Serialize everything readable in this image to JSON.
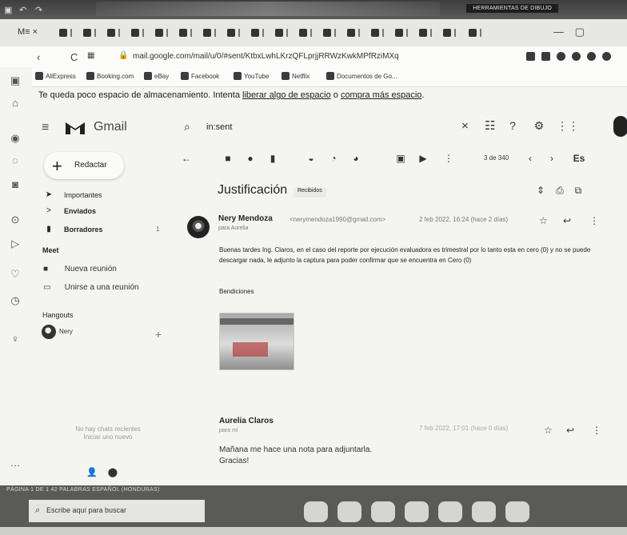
{
  "browser": {
    "word_title_mark": "HERRAMIENTAS DE DIBUJO",
    "tab_strip_text": "M≡  ×",
    "url": "mail.google.com/mail/u/0/#sent/KtbxLwhLKrzQFLprjjRRWzKwkMPfRziMXq",
    "bookmarks": [
      "AliExpress",
      "Booking.com",
      "eBay",
      "Facebook",
      "YouTube",
      "Netflix",
      "Documentos de Go..."
    ]
  },
  "banner": {
    "text": "Te queda poco espacio de almacenamiento. Intenta ",
    "link1": "liberar algo de espacio",
    "middle": " o ",
    "link2": "compra más espacio",
    "tail": "."
  },
  "gmail": {
    "brand": "Gmail",
    "search_value": "in:sent",
    "compose_label": "Redactar",
    "sidebar": [
      {
        "label": "Importantes",
        "count": "",
        "bold": false
      },
      {
        "label": "Enviados",
        "count": "",
        "bold": true
      },
      {
        "label": "Borradores",
        "count": "1",
        "bold": true
      }
    ],
    "meet_title": "Meet",
    "meet_items": [
      "Nueva reunión",
      "Unirse a una reunión"
    ],
    "hangouts_title": "Hangouts",
    "hangouts_user": "Nery",
    "no_chats": "No hay chats recientes\nIniciar uno nuevo",
    "pager": "3 de 340",
    "lang": "Es"
  },
  "thread": {
    "subject": "Justificación",
    "label": "Recibidos",
    "messages": [
      {
        "sender": "Nery Mendoza",
        "email": "<nerymendoza1990@gmail.com>",
        "date": "2 feb 2022, 16:24 (hace 2 días)",
        "to": "para Aurelia",
        "body": "Buenas tardes Ing. Claros, en el caso del reporte por ejecución evaluadora es trimestral por lo tanto esta en cero (0) y no se puede descargar nada, le adjunto la captura para poder confirmar que se encuentra en Cero (0)",
        "closing": "Bendiciones"
      },
      {
        "sender": "Aurelia Claros",
        "to": "para mí",
        "date": "7 feb 2022, 17:01 (hace 0 días)",
        "body": "Mañana me hace una nota para adjuntarla.\nGracias!"
      }
    ]
  },
  "taskbar": {
    "status": "PÁGINA 1 DE 1    42 PALABRAS    ESPAÑOL (HONDURAS)",
    "search_placeholder": "Escribe aquí para buscar"
  }
}
